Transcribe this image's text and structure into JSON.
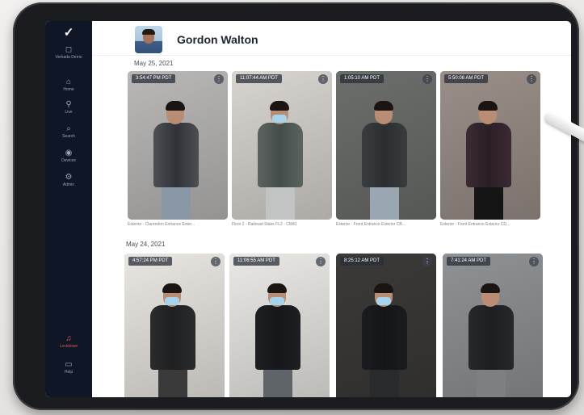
{
  "person": {
    "name": "Gordon Walton"
  },
  "sidebar": {
    "logo": "✓",
    "items": [
      {
        "icon": "◻",
        "label": "Verkada Demo",
        "icon_name": "org-icon"
      },
      {
        "icon": "⌂",
        "label": "Home",
        "icon_name": "home-icon"
      },
      {
        "icon": "⚲",
        "label": "Live",
        "icon_name": "live-icon"
      },
      {
        "icon": "⌕",
        "label": "Search",
        "icon_name": "search-icon"
      },
      {
        "icon": "◉",
        "label": "Devices",
        "icon_name": "devices-icon"
      },
      {
        "icon": "⚙",
        "label": "Admin",
        "icon_name": "admin-icon"
      },
      {
        "icon": "♫",
        "label": "Lockdown",
        "icon_name": "lockdown-icon"
      },
      {
        "icon": "▭",
        "label": "Help",
        "icon_name": "help-icon"
      }
    ]
  },
  "groups": [
    {
      "date": "May 25, 2021",
      "cards": [
        {
          "time": "3:54:47 PM PDT",
          "caption": "Exterior - Clarendon Entrance Exter...",
          "scene": "#b9b8b6",
          "top": "#4c4f53",
          "vest": "#2f3236",
          "legs": "#8a97a6",
          "mask": false
        },
        {
          "time": "11:07:44 AM PDT",
          "caption": "Floor 2 - Railroad Stairs FL2 - CM41",
          "scene": "#d8d4cf",
          "top": "#5b6460",
          "vest": "#454d4a",
          "legs": "#c2c4c3",
          "mask": true
        },
        {
          "time": "1:05:10 AM PDT",
          "caption": "Exterior - Front Entrance Exterior CB...",
          "scene": "#6b6e6a",
          "top": "#3a3d40",
          "vest": "#2b2e31",
          "legs": "#9aa6b2",
          "mask": false
        },
        {
          "time": "5:50:08 AM PDT",
          "caption": "Exterior - Front Entrance Exterior CD...",
          "scene": "#9a8f88",
          "top": "#3b2a33",
          "vest": "#2b1f26",
          "legs": "#151515",
          "mask": false
        }
      ]
    },
    {
      "date": "May 24, 2021",
      "cards": [
        {
          "time": "4:57:24 PM PDT",
          "caption": "",
          "scene": "#e9e6e1",
          "top": "#2a2b2d",
          "vest": "#1f2022",
          "legs": "#3a3a3a",
          "mask": true
        },
        {
          "time": "11:06:55 AM PDT",
          "caption": "",
          "scene": "#eae8e4",
          "top": "#1e1f22",
          "vest": "#16171a",
          "legs": "#5e6468",
          "mask": true
        },
        {
          "time": "8:25:12 AM PDT",
          "caption": "",
          "scene": "#3c3a38",
          "top": "#1b1c1f",
          "vest": "#141518",
          "legs": "#2a2b2d",
          "mask": true
        },
        {
          "time": "7:41:24 AM PDT",
          "caption": "",
          "scene": "#8f9294",
          "top": "#26282b",
          "vest": "#1c1e21",
          "legs": "#7d7f82",
          "mask": false
        }
      ]
    }
  ],
  "colors": {
    "sidebar_bg": "#0f1726",
    "alert": "#e0524f",
    "name_text": "#1e2430"
  }
}
